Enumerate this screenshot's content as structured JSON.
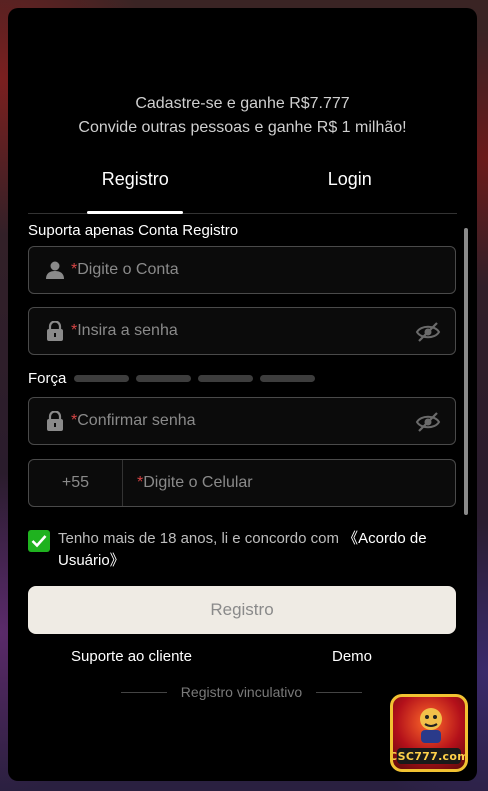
{
  "promo": {
    "line1": "Cadastre-se e ganhe R$7.777",
    "line2": "Convide outras pessoas e ganhe R$ 1 milhão!"
  },
  "tabs": [
    {
      "label": "Registro",
      "active": true
    },
    {
      "label": "Login",
      "active": false
    }
  ],
  "form": {
    "support_note": "Suporta apenas Conta Registro",
    "required_mark": "*",
    "account_placeholder": "Digite o Conta",
    "password_placeholder": "Insira a senha",
    "strength_label": "Força",
    "confirm_placeholder": "Confirmar senha",
    "phone_code": "+55",
    "phone_placeholder": "Digite o Celular",
    "agree_text": "Tenho mais de 18 anos, li e concordo com ",
    "agree_link": "《Acordo de Usuário》",
    "agree_checked": true,
    "submit_label": "Registro"
  },
  "links": {
    "support": "Suporte ao cliente",
    "demo": "Demo"
  },
  "divider_text": "Registro vinculativo",
  "badge": {
    "brand": "CSC777.com"
  },
  "colors": {
    "accent_green": "#1fb21f",
    "button_bg": "#efebe4",
    "required_red": "#d64545"
  }
}
